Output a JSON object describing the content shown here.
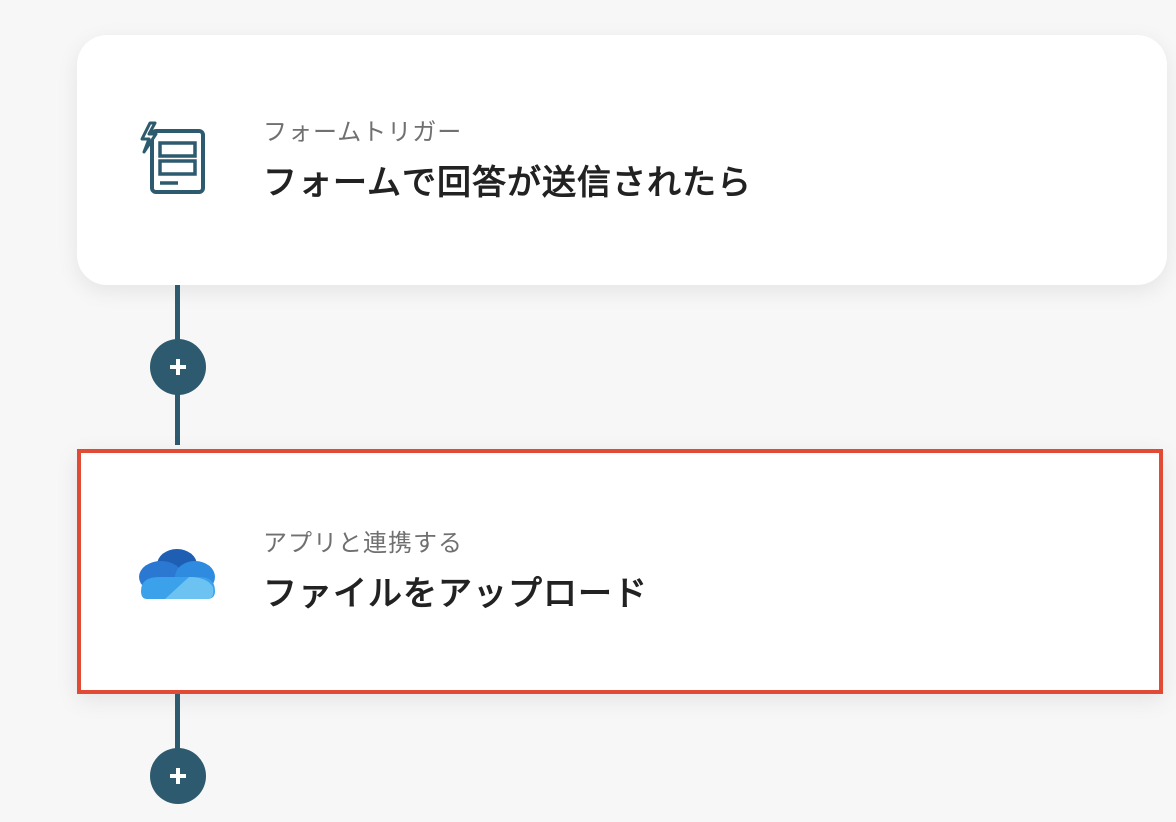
{
  "flow": {
    "trigger": {
      "subtitle": "フォームトリガー",
      "title": "フォームで回答が送信されたら",
      "icon": "form-trigger-icon"
    },
    "action": {
      "subtitle": "アプリと連携する",
      "title": "ファイルをアップロード",
      "icon": "onedrive-cloud-icon"
    },
    "add_step_icon": "plus-icon"
  },
  "colors": {
    "connector": "#2d5a6e",
    "highlight_border": "#e14a35",
    "background": "#f7f7f7"
  }
}
